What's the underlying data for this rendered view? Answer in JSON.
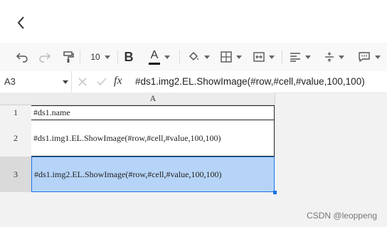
{
  "toolbar": {
    "font_size": "10",
    "bold_label": "B",
    "font_color_label": "A",
    "font_color": "#111111"
  },
  "formula_bar": {
    "cell_ref": "A3",
    "fx_label": "fx",
    "formula": "#ds1.img2.EL.ShowImage(#row,#cell,#value,100,100)"
  },
  "sheet": {
    "column_header": "A",
    "rows": [
      {
        "num": "1",
        "value": "#ds1.name"
      },
      {
        "num": "2",
        "value": "#ds1.img1.EL.ShowImage(#row,#cell,#value,100,100)"
      },
      {
        "num": "3",
        "value": "#ds1.img2.EL.ShowImage(#row,#cell,#value,100,100)"
      }
    ]
  },
  "watermark": "CSDN @leoppeng",
  "colors": {
    "selection": "#b6d4f7",
    "accent": "#1a73e8"
  }
}
